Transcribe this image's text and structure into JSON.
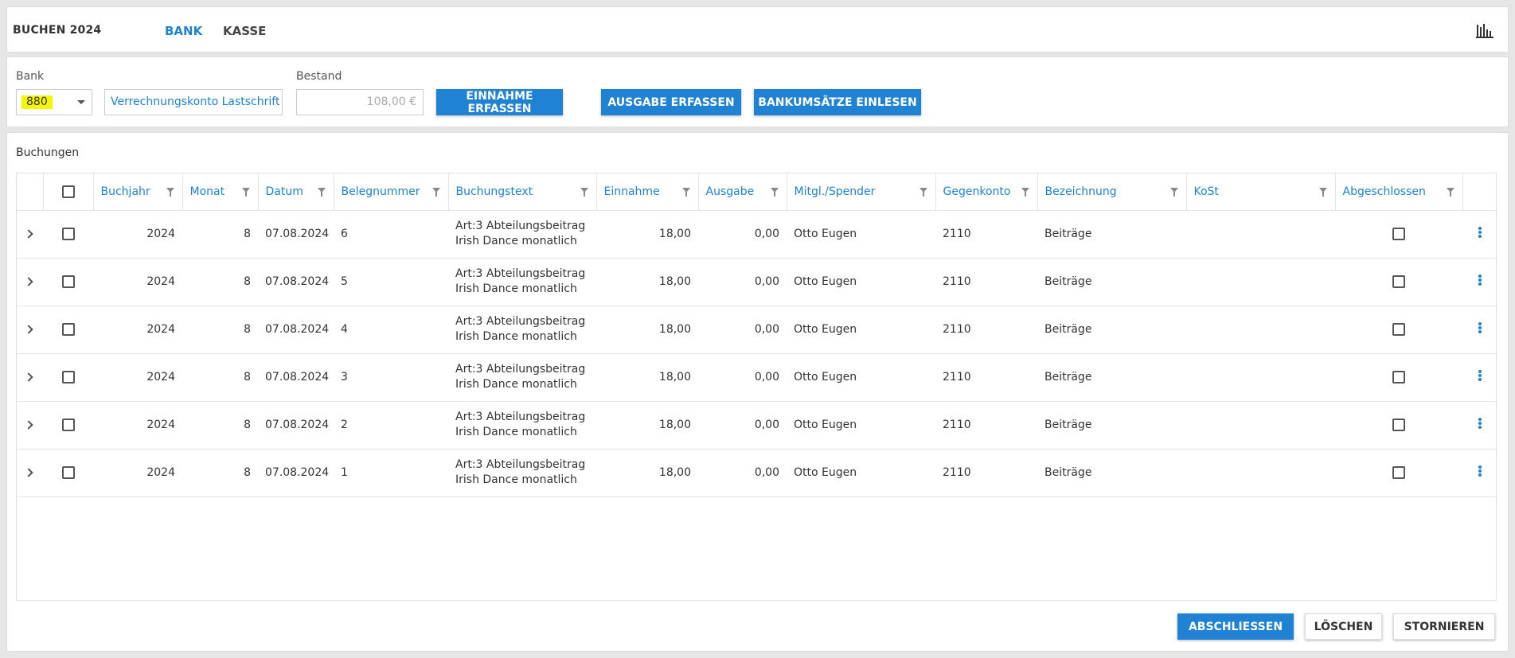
{
  "header": {
    "title": "BUCHEN 2024",
    "tabs": [
      {
        "label": "BANK",
        "active": true
      },
      {
        "label": "KASSE",
        "active": false
      }
    ],
    "chart_icon": "bar-chart-icon"
  },
  "toolbar": {
    "bank_label": "Bank",
    "bank_value": "880",
    "bank_name": "Verrechnungskonto Lastschrift",
    "bestand_label": "Bestand",
    "bestand_value": "108,00 €",
    "einnahme_label": "EINNAHME ERFASSEN",
    "ausgabe_label": "AUSGABE ERFASSEN",
    "bankumsaetze_label": "BANKUMSÄTZE EINLESEN"
  },
  "buchungen": {
    "title": "Buchungen",
    "columns": [
      "Buchjahr",
      "Monat",
      "Datum",
      "Belegnummer",
      "Buchungstext",
      "Einnahme",
      "Ausgabe",
      "Mitgl./Spender",
      "Gegenkonto",
      "Bezeichnung",
      "KoSt",
      "Abgeschlossen"
    ],
    "rows": [
      {
        "buchjahr": "2024",
        "monat": "8",
        "datum": "07.08.2024",
        "beleg": "6",
        "text": "Art:3 Abteilungsbeitrag Irish Dance monatlich",
        "einnahme": "18,00",
        "ausgabe": "0,00",
        "mitglied": "Otto Eugen",
        "gegenkonto": "2110",
        "bezeichnung": "Beiträge",
        "kost": ""
      },
      {
        "buchjahr": "2024",
        "monat": "8",
        "datum": "07.08.2024",
        "beleg": "5",
        "text": "Art:3 Abteilungsbeitrag Irish Dance monatlich",
        "einnahme": "18,00",
        "ausgabe": "0,00",
        "mitglied": "Otto Eugen",
        "gegenkonto": "2110",
        "bezeichnung": "Beiträge",
        "kost": ""
      },
      {
        "buchjahr": "2024",
        "monat": "8",
        "datum": "07.08.2024",
        "beleg": "4",
        "text": "Art:3 Abteilungsbeitrag Irish Dance monatlich",
        "einnahme": "18,00",
        "ausgabe": "0,00",
        "mitglied": "Otto Eugen",
        "gegenkonto": "2110",
        "bezeichnung": "Beiträge",
        "kost": ""
      },
      {
        "buchjahr": "2024",
        "monat": "8",
        "datum": "07.08.2024",
        "beleg": "3",
        "text": "Art:3 Abteilungsbeitrag Irish Dance monatlich",
        "einnahme": "18,00",
        "ausgabe": "0,00",
        "mitglied": "Otto Eugen",
        "gegenkonto": "2110",
        "bezeichnung": "Beiträge",
        "kost": ""
      },
      {
        "buchjahr": "2024",
        "monat": "8",
        "datum": "07.08.2024",
        "beleg": "2",
        "text": "Art:3 Abteilungsbeitrag Irish Dance monatlich",
        "einnahme": "18,00",
        "ausgabe": "0,00",
        "mitglied": "Otto Eugen",
        "gegenkonto": "2110",
        "bezeichnung": "Beiträge",
        "kost": ""
      },
      {
        "buchjahr": "2024",
        "monat": "8",
        "datum": "07.08.2024",
        "beleg": "1",
        "text": "Art:3 Abteilungsbeitrag Irish Dance monatlich",
        "einnahme": "18,00",
        "ausgabe": "0,00",
        "mitglied": "Otto Eugen",
        "gegenkonto": "2110",
        "bezeichnung": "Beiträge",
        "kost": ""
      }
    ]
  },
  "footer": {
    "abschliessen_label": "ABSCHLIESSEN",
    "loeschen_label": "LÖSCHEN",
    "stornieren_label": "STORNIEREN"
  },
  "colors": {
    "accent": "#1f82d2",
    "highlight": "#f6f600"
  }
}
